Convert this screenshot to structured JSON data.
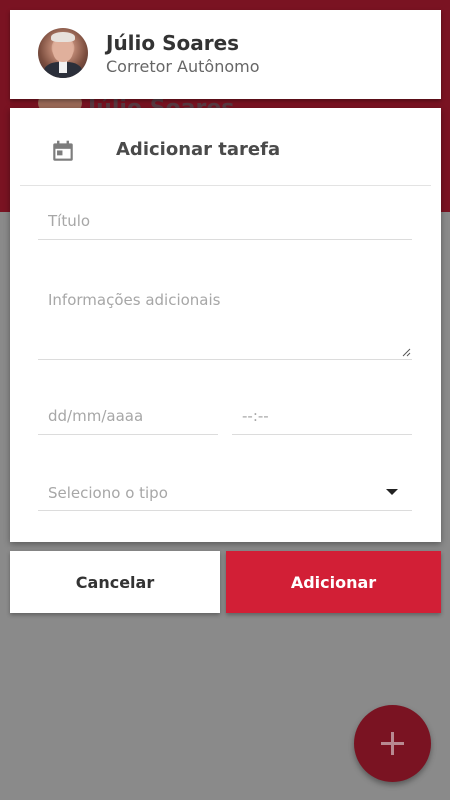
{
  "profile": {
    "name": "Júlio Soares",
    "role": "Corretor Autônomo"
  },
  "background": {
    "peek_name": "Júlio Soares"
  },
  "dialog": {
    "title": "Adicionar tarefa",
    "title_icon": "calendar-icon",
    "fields": {
      "title_placeholder": "Título",
      "info_placeholder": "Informações adicionais",
      "date_placeholder": "dd/mm/aaaa",
      "time_placeholder": "--:--",
      "type_placeholder": "Seleciono o tipo"
    }
  },
  "actions": {
    "cancel_label": "Cancelar",
    "add_label": "Adicionar"
  },
  "fab": {
    "icon": "plus-icon"
  },
  "colors": {
    "brand_dark": "#7a1322",
    "accent": "#d21f36",
    "overlay": "#8a8a8a"
  }
}
